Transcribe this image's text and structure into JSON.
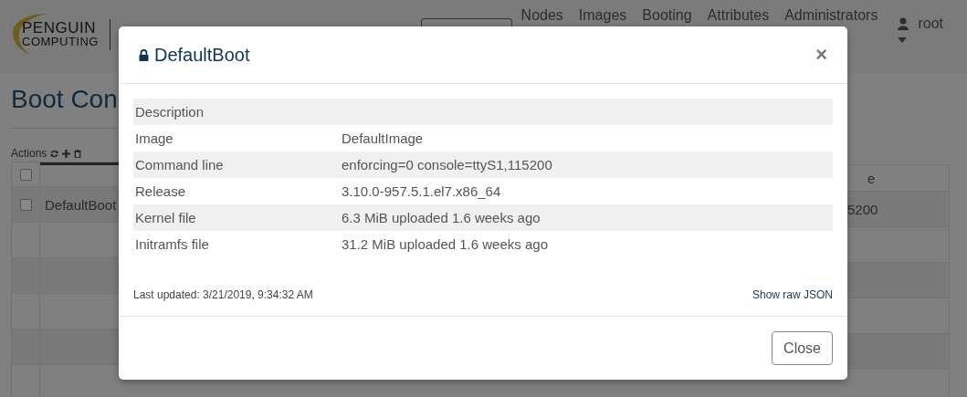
{
  "header": {
    "logo": {
      "line_1": "PENGUIN",
      "line_2": "COMPUTING"
    },
    "nav": [
      "Nodes",
      "Images",
      "Booting",
      "Attributes",
      "Administrators"
    ],
    "user": "root"
  },
  "page": {
    "title": "Boot Con",
    "actions_label": "Actions",
    "select_all_checked": false,
    "header_right": "e",
    "rows": [
      {
        "name": "DefaultBoot",
        "last": "5200",
        "checked": false
      }
    ]
  },
  "modal": {
    "title": "DefaultBoot",
    "locked": true,
    "close_icon": "×",
    "fields": [
      {
        "label": "Description"
      },
      {
        "label": "Image",
        "value": "DefaultImage"
      },
      {
        "label": "Command line",
        "value": "enforcing=0 console=ttyS1,115200"
      },
      {
        "label": "Release",
        "value": "3.10.0-957.5.1.el7.x86_64"
      },
      {
        "label": "Kernel file",
        "value": "6.3 MiB uploaded 1.6 weeks ago"
      },
      {
        "label": "Initramfs file",
        "value": "31.2 MiB uploaded 1.6 weeks ago"
      }
    ],
    "last_updated": "Last updated: 3/21/2019, 9:34:32 AM",
    "raw_link": "Show raw JSON",
    "close_button": "Close"
  }
}
